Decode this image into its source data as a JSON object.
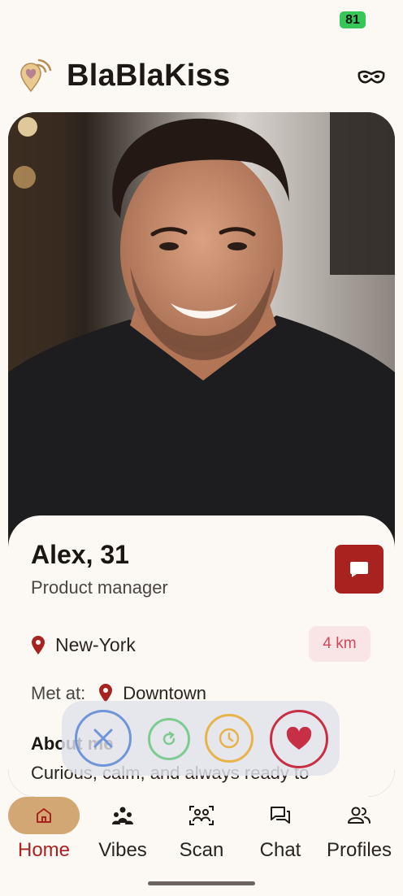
{
  "status": {
    "battery": "81"
  },
  "header": {
    "title": "BlaBlaKiss",
    "mask_icon": "mask-icon",
    "logo_icon": "heart-pin-logo"
  },
  "profile": {
    "name_age": "Alex, 31",
    "job": "Product manager",
    "location": "New-York",
    "distance": "4 km",
    "met_label": "Met at:",
    "met_place": "Downtown",
    "about_title": "About me",
    "about_text": "Curious, calm, and always ready to"
  },
  "actions": [
    {
      "name": "pass",
      "icon": "close-icon",
      "color": "#6f96d6"
    },
    {
      "name": "rewind",
      "icon": "rewind-icon",
      "color": "#7ecb92"
    },
    {
      "name": "later",
      "icon": "clock-icon",
      "color": "#e8b44a"
    },
    {
      "name": "like",
      "icon": "heart-icon",
      "color": "#c72f45"
    }
  ],
  "tabs": [
    {
      "label": "Home",
      "icon": "home-icon",
      "active": true
    },
    {
      "label": "Vibes",
      "icon": "vibes-icon",
      "active": false
    },
    {
      "label": "Scan",
      "icon": "scan-icon",
      "active": false
    },
    {
      "label": "Chat",
      "icon": "chat-icon",
      "active": false
    },
    {
      "label": "Profiles",
      "icon": "profiles-icon",
      "active": false
    }
  ],
  "colors": {
    "accent": "#a8231f",
    "background": "#fcf8f4",
    "active_tab": "#d3a774"
  }
}
